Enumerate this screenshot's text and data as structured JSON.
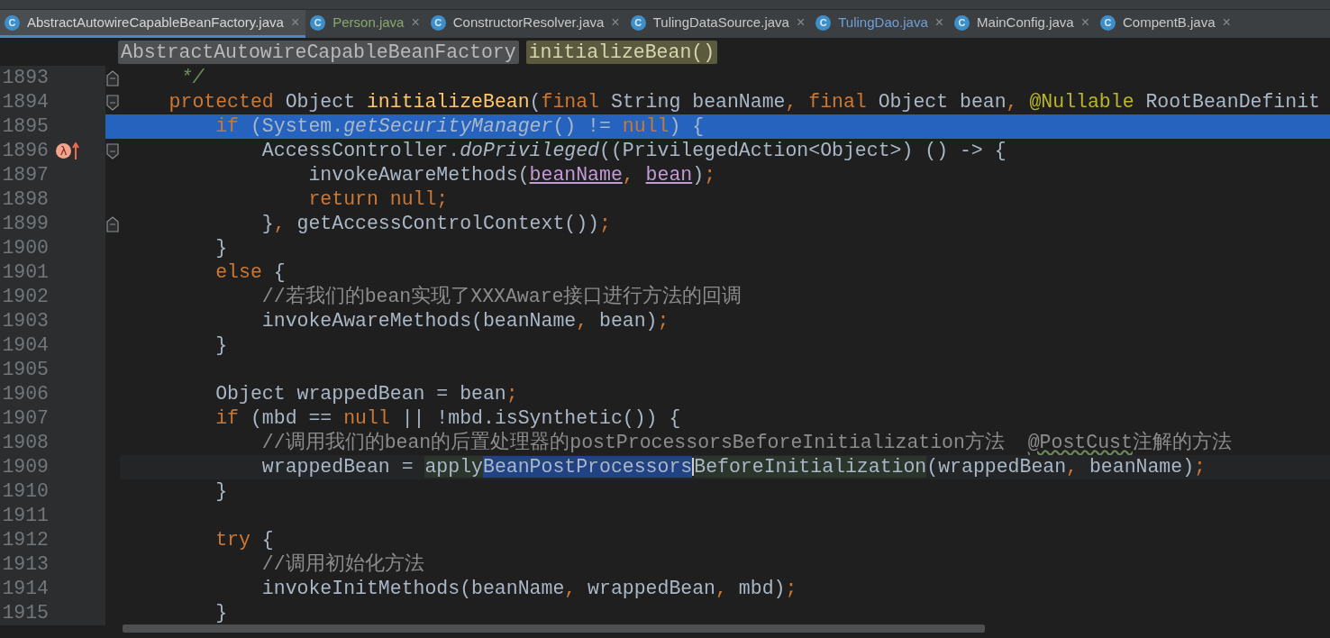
{
  "tabs": [
    {
      "label": "AbstractAutowireCapableBeanFactory.java",
      "icon": "C",
      "close": "×",
      "selected": true,
      "color": "#d6d6d6"
    },
    {
      "label": "Person.java",
      "icon": "C",
      "close": "×",
      "selected": false,
      "color": "#8aa86d"
    },
    {
      "label": "ConstructorResolver.java",
      "icon": "C",
      "close": "×",
      "selected": false,
      "color": "#c8c8c8"
    },
    {
      "label": "TulingDataSource.java",
      "icon": "C",
      "close": "×",
      "selected": false,
      "color": "#c8c8c8"
    },
    {
      "label": "TulingDao.java",
      "icon": "C",
      "close": "×",
      "selected": false,
      "color": "#6f9fd8"
    },
    {
      "label": "MainConfig.java",
      "icon": "C",
      "close": "×",
      "selected": false,
      "color": "#c8c8c8"
    },
    {
      "label": "CompentB.java",
      "icon": "C",
      "close": "×",
      "selected": false,
      "color": "#c8c8c8"
    }
  ],
  "breadcrumbs": [
    {
      "label": "AbstractAutowireCapableBeanFactory",
      "kind": "class"
    },
    {
      "label": "initializeBean()",
      "kind": "method"
    }
  ],
  "lines": [
    {
      "number": "1893",
      "fold_end": true,
      "tokens": [
        {
          "text": "     */",
          "kind": "doc"
        }
      ]
    },
    {
      "number": "1894",
      "fold_start": true,
      "tokens": [
        {
          "text": "    protected",
          "kind": "keyword"
        },
        {
          "text": " Object ",
          "kind": "plain"
        },
        {
          "text": "initializeBean",
          "kind": "declaration"
        },
        {
          "text": "(",
          "kind": "plain"
        },
        {
          "text": "final",
          "kind": "keyword"
        },
        {
          "text": " String beanName",
          "kind": "plain"
        },
        {
          "text": ", ",
          "kind": "keyword"
        },
        {
          "text": "final",
          "kind": "keyword"
        },
        {
          "text": " Object bean",
          "kind": "plain"
        },
        {
          "text": ", ",
          "kind": "keyword"
        },
        {
          "text": "@Nullable",
          "kind": "annotation"
        },
        {
          "text": " RootBeanDefinit",
          "kind": "plain"
        }
      ]
    },
    {
      "number": "1895",
      "execution_point": true,
      "tokens": [
        {
          "text": "        if",
          "kind": "keyword"
        },
        {
          "text": " (System.",
          "kind": "plain"
        },
        {
          "text": "getSecurityManager",
          "kind": "static"
        },
        {
          "text": "() != ",
          "kind": "plain"
        },
        {
          "text": "null",
          "kind": "keyword"
        },
        {
          "text": ") {",
          "kind": "plain"
        }
      ]
    },
    {
      "number": "1896",
      "fold_start": true,
      "marker": "λ",
      "tokens": [
        {
          "text": "            AccessController.",
          "kind": "plain"
        },
        {
          "text": "doPrivileged",
          "kind": "static"
        },
        {
          "text": "((PrivilegedAction<Object>) () -> {",
          "kind": "plain"
        }
      ]
    },
    {
      "number": "1897",
      "tokens": [
        {
          "text": "                invokeAwareMethods(",
          "kind": "plain"
        },
        {
          "text": "beanName",
          "kind": "captured"
        },
        {
          "text": ", ",
          "kind": "keyword"
        },
        {
          "text": "bean",
          "kind": "captured"
        },
        {
          "text": ")",
          "kind": "plain"
        },
        {
          "text": ";",
          "kind": "keyword"
        }
      ]
    },
    {
      "number": "1898",
      "tokens": [
        {
          "text": "                return null;",
          "kind": "keyword"
        }
      ]
    },
    {
      "number": "1899",
      "fold_end": true,
      "tokens": [
        {
          "text": "            }",
          "kind": "plain"
        },
        {
          "text": ", ",
          "kind": "keyword"
        },
        {
          "text": "getAccessControlContext())",
          "kind": "plain"
        },
        {
          "text": ";",
          "kind": "keyword"
        }
      ]
    },
    {
      "number": "1900",
      "tokens": [
        {
          "text": "        }",
          "kind": "plain"
        }
      ]
    },
    {
      "number": "1901",
      "tokens": [
        {
          "text": "        else",
          "kind": "keyword"
        },
        {
          "text": " {",
          "kind": "plain"
        }
      ]
    },
    {
      "number": "1902",
      "tokens": [
        {
          "text": "            //若我们的bean实现了XXXAware接口进行方法的回调",
          "kind": "comment"
        }
      ]
    },
    {
      "number": "1903",
      "tokens": [
        {
          "text": "            invokeAwareMethods(beanName",
          "kind": "plain"
        },
        {
          "text": ", ",
          "kind": "keyword"
        },
        {
          "text": "bean)",
          "kind": "plain"
        },
        {
          "text": ";",
          "kind": "keyword"
        }
      ]
    },
    {
      "number": "1904",
      "tokens": [
        {
          "text": "        }",
          "kind": "plain"
        }
      ]
    },
    {
      "number": "1905"
    },
    {
      "number": "1906",
      "tokens": [
        {
          "text": "        Object wrappedBean = bean",
          "kind": "plain"
        },
        {
          "text": ";",
          "kind": "keyword"
        }
      ]
    },
    {
      "number": "1907",
      "tokens": [
        {
          "text": "        if",
          "kind": "keyword"
        },
        {
          "text": " (mbd == ",
          "kind": "plain"
        },
        {
          "text": "null",
          "kind": "keyword"
        },
        {
          "text": " || !mbd.isSynthetic()) {",
          "kind": "plain"
        }
      ]
    },
    {
      "number": "1908",
      "tokens": [
        {
          "text": "            //调用我们的bean的后置处理器的postProcessorsBeforeInitialization方法  ",
          "kind": "comment"
        },
        {
          "text": "@PostCust",
          "kind": "typo"
        },
        {
          "text": "注解的方法",
          "kind": "comment"
        }
      ]
    },
    {
      "number": "1909",
      "caret_line": true,
      "tokens": [
        {
          "text": "            wrappedBean = ",
          "kind": "plain"
        },
        {
          "text": "apply",
          "kind": "usage"
        },
        {
          "text": "BeanPostProcessors",
          "kind": "usage",
          "selected": true,
          "caret": true
        },
        {
          "text": "BeforeInitialization",
          "kind": "usage"
        },
        {
          "text": "(wrappedBean",
          "kind": "plain"
        },
        {
          "text": ", ",
          "kind": "keyword"
        },
        {
          "text": "beanName)",
          "kind": "plain"
        },
        {
          "text": ";",
          "kind": "keyword"
        }
      ]
    },
    {
      "number": "1910",
      "tokens": [
        {
          "text": "        }",
          "kind": "plain"
        }
      ]
    },
    {
      "number": "1911"
    },
    {
      "number": "1912",
      "tokens": [
        {
          "text": "        try",
          "kind": "keyword"
        },
        {
          "text": " {",
          "kind": "plain"
        }
      ]
    },
    {
      "number": "1913",
      "tokens": [
        {
          "text": "            //调用初始化方法",
          "kind": "comment"
        }
      ]
    },
    {
      "number": "1914",
      "tokens": [
        {
          "text": "            invokeInitMethods(beanName",
          "kind": "plain"
        },
        {
          "text": ", ",
          "kind": "keyword"
        },
        {
          "text": "wrappedBean",
          "kind": "plain"
        },
        {
          "text": ", ",
          "kind": "keyword"
        },
        {
          "text": "mbd)",
          "kind": "plain"
        },
        {
          "text": ";",
          "kind": "keyword"
        }
      ]
    },
    {
      "number": "1915",
      "tokens": [
        {
          "text": "        }",
          "kind": "plain"
        }
      ]
    }
  ]
}
